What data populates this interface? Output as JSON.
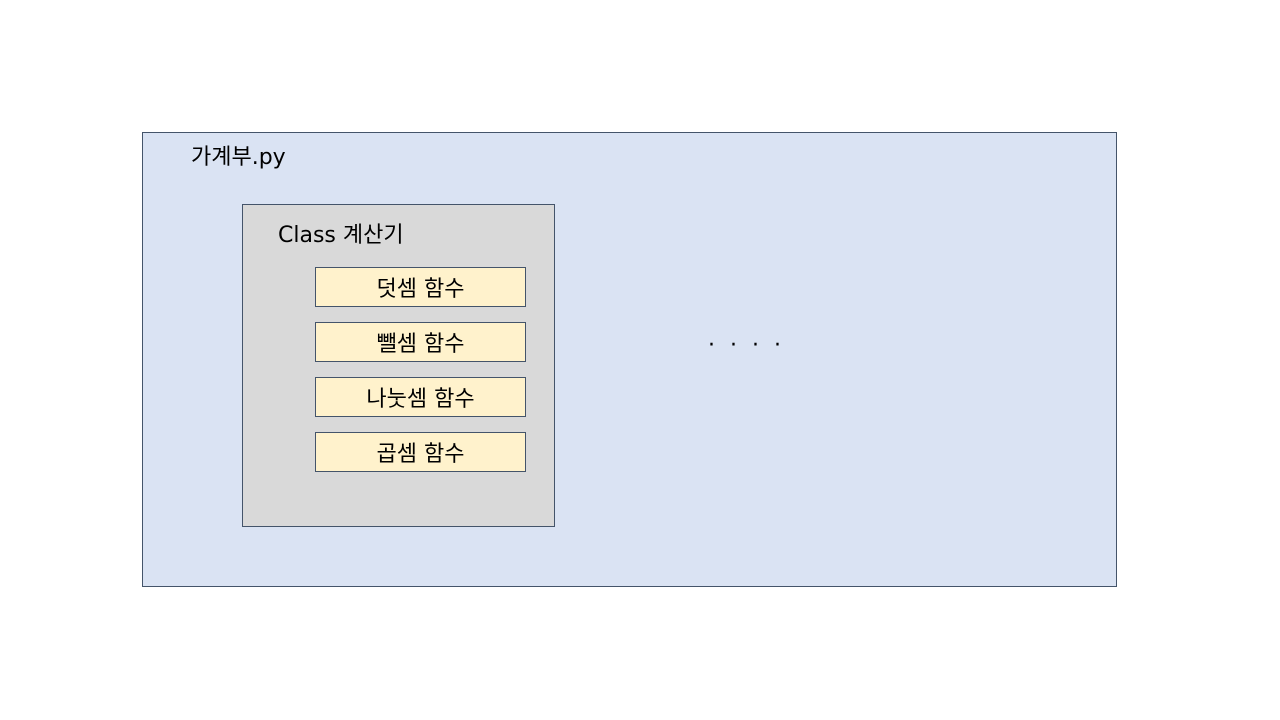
{
  "file": {
    "title": "가계부.py",
    "color": "#dae3f3"
  },
  "class_block": {
    "title": "Class  계산기",
    "color": "#d9d9d9",
    "functions": [
      "덧셈 함수",
      "뺄셈 함수",
      "나눗셈 함수",
      "곱셈 함수"
    ],
    "function_color": "#fff2cc"
  },
  "ellipsis": "· · · ·",
  "border_color": "#44546a"
}
